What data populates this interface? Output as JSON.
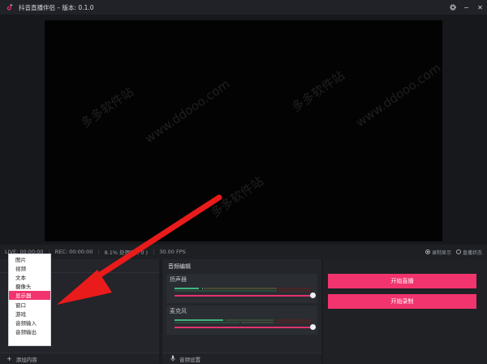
{
  "app": {
    "title": "抖音直播伴侣 – 版本: 0.1.0"
  },
  "window_controls": {
    "settings_icon": "gear-icon",
    "minimize": "−",
    "close": "✕"
  },
  "statusbar": {
    "live": "LIVE: 00:00:00",
    "rec": "REC: 00:00:00",
    "cpu": "8.1% 处理器 ( 0 )",
    "fps": "30.00 FPS",
    "radio_record_display": "录制显示",
    "radio_live_status": "直播状态"
  },
  "sources_menu": {
    "items": [
      "图片",
      "视频",
      "文本",
      "摄像头",
      "显示器",
      "窗口",
      "游戏",
      "音频输入",
      "音频输出"
    ],
    "active_index": 4
  },
  "sources_panel": {
    "add_label": "添加内容"
  },
  "audio": {
    "title": "音频编辑",
    "speaker_label": "扬声器",
    "mic_label": "麦克风",
    "settings_label": "音频设置",
    "speaker_volume": 1.0,
    "mic_volume": 1.0
  },
  "actions": {
    "start_live": "开始直播",
    "start_record": "开始录制"
  },
  "watermark": {
    "cn": "多多软件站",
    "url": "www.ddooo.com"
  },
  "colors": {
    "accent": "#f2346e",
    "meter_green": "#3fb37f",
    "meter_yellow": "#9aa030",
    "meter_red": "#b0342f"
  }
}
